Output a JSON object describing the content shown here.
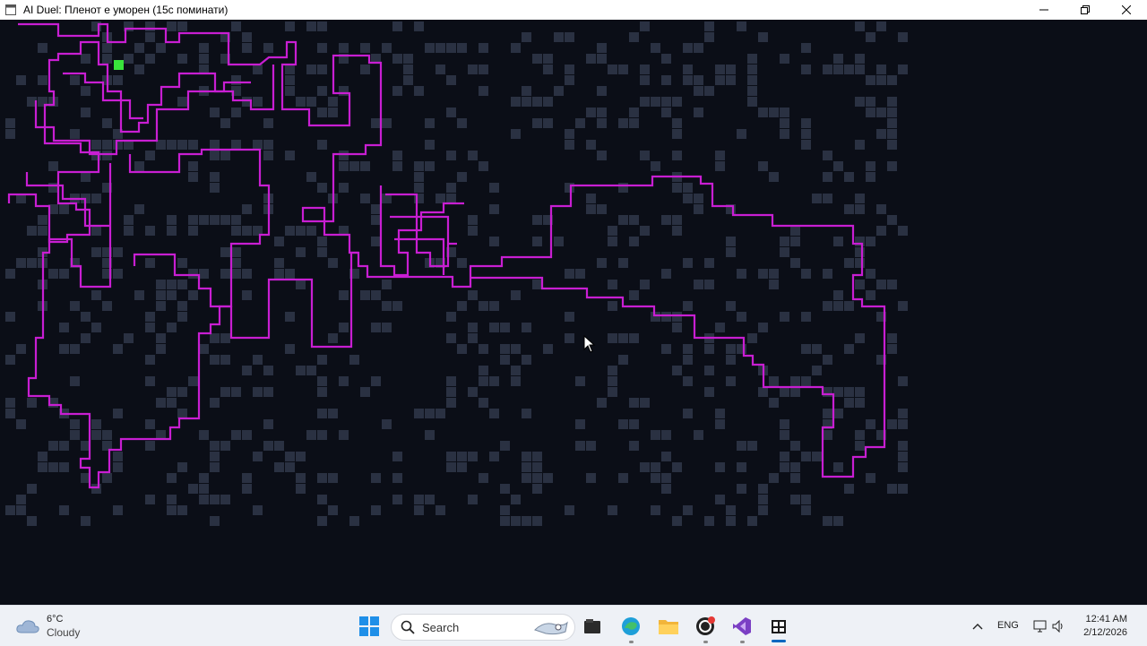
{
  "window": {
    "title": "AI Duel: Пленот е уморен (15с поминати)"
  },
  "game": {
    "colors": {
      "background": "#0b0e17",
      "obstacle": "#2a3142",
      "trail": "#c81ed2",
      "player": "#39e33b"
    }
  },
  "taskbar": {
    "weather": {
      "temp": "6°C",
      "condition": "Cloudy"
    },
    "search_label": "Search",
    "pinned": [
      "start-icon",
      "search-icon",
      "file-explorer-icon",
      "edge-icon",
      "folder-icon",
      "obs-icon",
      "visual-studio-icon",
      "app-icon"
    ],
    "tray": {
      "language": "ENG"
    },
    "clock": {
      "time": "12:41 AM",
      "date": "2/12/2026"
    }
  }
}
